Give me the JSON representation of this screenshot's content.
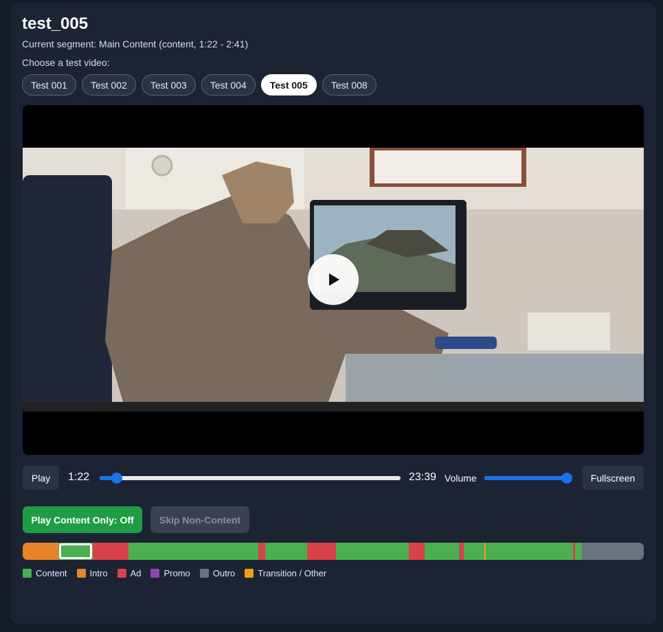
{
  "title": "test_005",
  "current_segment_text": "Current segment: Main Content (content, 1:22 - 2:41)",
  "choose_label": "Choose a test video:",
  "video_tabs": [
    {
      "label": "Test 001",
      "active": false
    },
    {
      "label": "Test 002",
      "active": false
    },
    {
      "label": "Test 003",
      "active": false
    },
    {
      "label": "Test 004",
      "active": false
    },
    {
      "label": "Test 005",
      "active": true
    },
    {
      "label": "Test 008",
      "active": false
    }
  ],
  "player": {
    "play_label": "Play",
    "current_time": "1:22",
    "duration": "23:39",
    "progress_fraction": 0.058,
    "volume_label": "Volume",
    "volume_fraction": 1.0,
    "fullscreen_label": "Fullscreen"
  },
  "buttons": {
    "play_content_only": "Play Content Only: Off",
    "skip_non_content": "Skip Non-Content"
  },
  "colors": {
    "content": "#4caf50",
    "intro": "#e8832a",
    "ad": "#d9424a",
    "promo": "#8e44ad",
    "outro": "#6b7280",
    "transition": "#f39c12",
    "accent": "#1a73e8"
  },
  "timeline_segments": [
    {
      "type": "intro",
      "fraction": 0.058
    },
    {
      "type": "content",
      "fraction": 0.055,
      "current": true
    },
    {
      "type": "ad",
      "fraction": 0.057
    },
    {
      "type": "content",
      "fraction": 0.209
    },
    {
      "type": "ad",
      "fraction": 0.011
    },
    {
      "type": "content",
      "fraction": 0.068
    },
    {
      "type": "ad",
      "fraction": 0.046
    },
    {
      "type": "content",
      "fraction": 0.118
    },
    {
      "type": "ad",
      "fraction": 0.025
    },
    {
      "type": "content",
      "fraction": 0.056
    },
    {
      "type": "ad",
      "fraction": 0.007
    },
    {
      "type": "content",
      "fraction": 0.033
    },
    {
      "type": "transition",
      "fraction": 0.003
    },
    {
      "type": "content",
      "fraction": 0.14
    },
    {
      "type": "ad",
      "fraction": 0.003
    },
    {
      "type": "content",
      "fraction": 0.011
    },
    {
      "type": "outro",
      "fraction": 0.1
    }
  ],
  "legend": [
    {
      "label": "Content",
      "color": "#4caf50"
    },
    {
      "label": "Intro",
      "color": "#e8832a"
    },
    {
      "label": "Ad",
      "color": "#d9424a"
    },
    {
      "label": "Promo",
      "color": "#8e44ad"
    },
    {
      "label": "Outro",
      "color": "#6b7280"
    },
    {
      "label": "Transition / Other",
      "color": "#f39c12"
    }
  ]
}
